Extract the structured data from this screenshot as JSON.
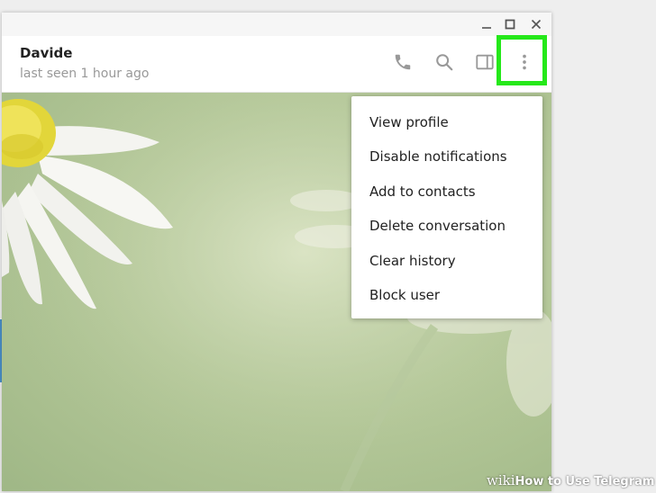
{
  "window": {
    "minimize_icon": "minimize-icon",
    "maximize_icon": "maximize-icon",
    "close_icon": "close-icon"
  },
  "header": {
    "contact_name": "Davide",
    "status": "last seen 1 hour ago",
    "icons": [
      "phone-icon",
      "search-icon",
      "sidebar-toggle-icon",
      "more-vertical-icon"
    ],
    "highlight_color": "#25e81a"
  },
  "menu": {
    "items": [
      {
        "label": "View profile"
      },
      {
        "label": "Disable notifications"
      },
      {
        "label": "Add to contacts"
      },
      {
        "label": "Delete conversation"
      },
      {
        "label": "Clear history"
      },
      {
        "label": "Block user"
      }
    ]
  },
  "watermark": {
    "brand": "wiki",
    "text": "How to Use Telegram"
  }
}
